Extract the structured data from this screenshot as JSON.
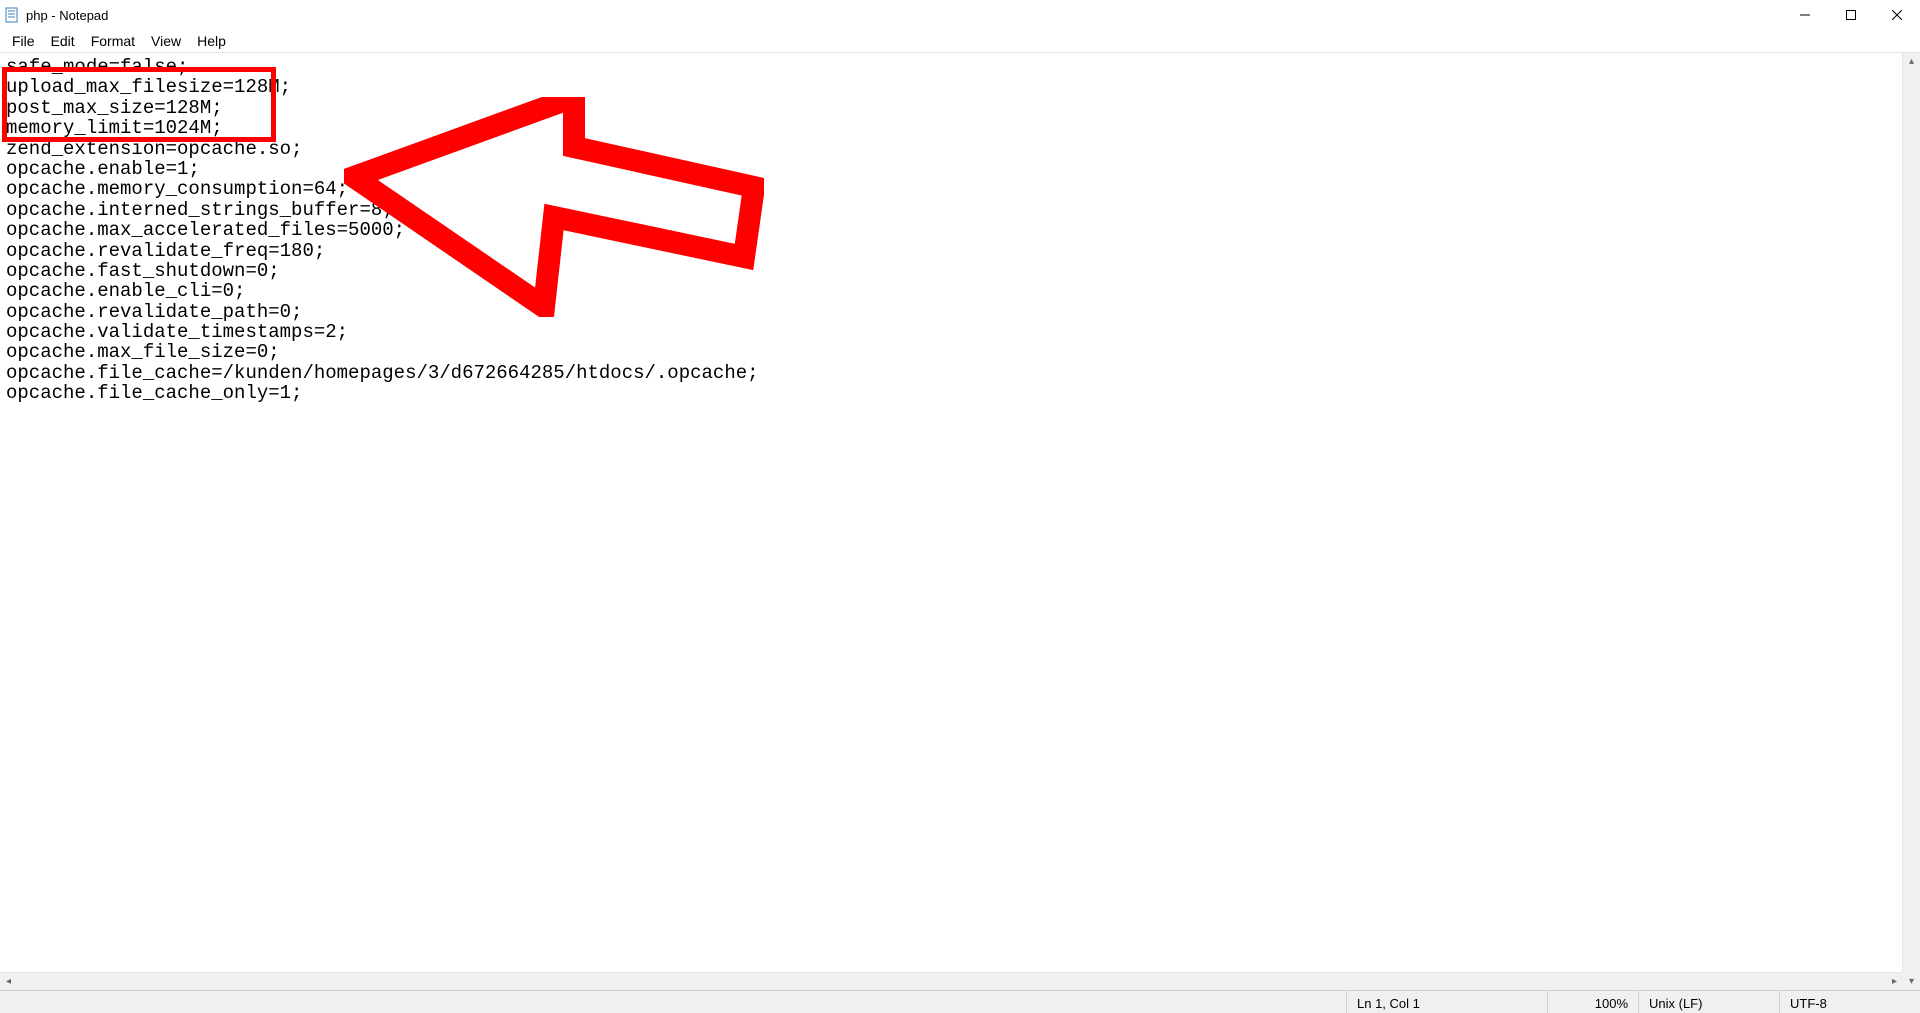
{
  "window": {
    "title": "php - Notepad"
  },
  "menu": {
    "file": "File",
    "edit": "Edit",
    "format": "Format",
    "view": "View",
    "help": "Help"
  },
  "editor": {
    "lines": [
      "safe_mode=false;",
      "upload_max_filesize=128M;",
      "post_max_size=128M;",
      "memory_limit=1024M;",
      "zend_extension=opcache.so;",
      "opcache.enable=1;",
      "opcache.memory_consumption=64;",
      "opcache.interned_strings_buffer=8;",
      "opcache.max_accelerated_files=5000;",
      "opcache.revalidate_freq=180;",
      "opcache.fast_shutdown=0;",
      "opcache.enable_cli=0;",
      "opcache.revalidate_path=0;",
      "opcache.validate_timestamps=2;",
      "opcache.max_file_size=0;",
      "opcache.file_cache=/kunden/homepages/3/d672664285/htdocs/.opcache;",
      "opcache.file_cache_only=1;"
    ]
  },
  "annotation": {
    "highlight_lines": [
      1,
      2,
      3
    ],
    "color": "#ff0000"
  },
  "status": {
    "position": "Ln 1, Col 1",
    "zoom": "100%",
    "line_ending": "Unix (LF)",
    "encoding": "UTF-8"
  }
}
